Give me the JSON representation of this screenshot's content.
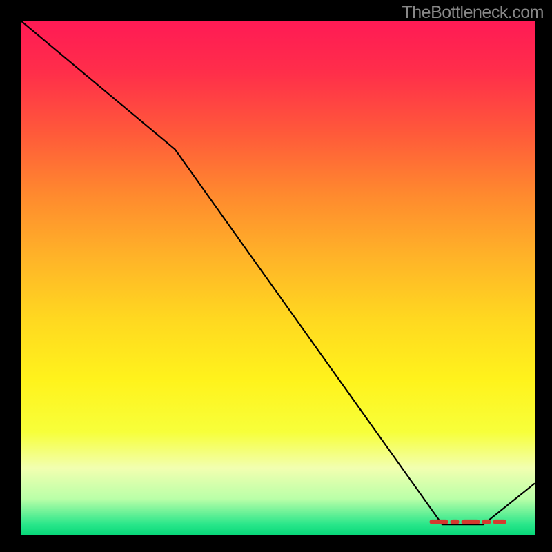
{
  "watermark": "TheBottleneck.com",
  "chart_data": {
    "type": "line",
    "title": "",
    "xlabel": "",
    "ylabel": "",
    "xlim": [
      0,
      100
    ],
    "ylim": [
      0,
      100
    ],
    "grid": false,
    "series": [
      {
        "name": "bottleneck-curve",
        "x": [
          0,
          30,
          82,
          90,
          100
        ],
        "y": [
          100,
          75,
          2,
          2,
          10
        ]
      }
    ],
    "highlight_segment": {
      "name": "optimal-zone",
      "x_start": 80,
      "x_end": 94,
      "y": 2.5
    },
    "background_gradient": {
      "direction": "top-to-bottom",
      "stops": [
        {
          "pos": 0.0,
          "color": "#ff1a55"
        },
        {
          "pos": 0.5,
          "color": "#ffd820"
        },
        {
          "pos": 0.8,
          "color": "#f7ff3a"
        },
        {
          "pos": 1.0,
          "color": "#08d879"
        }
      ]
    }
  }
}
